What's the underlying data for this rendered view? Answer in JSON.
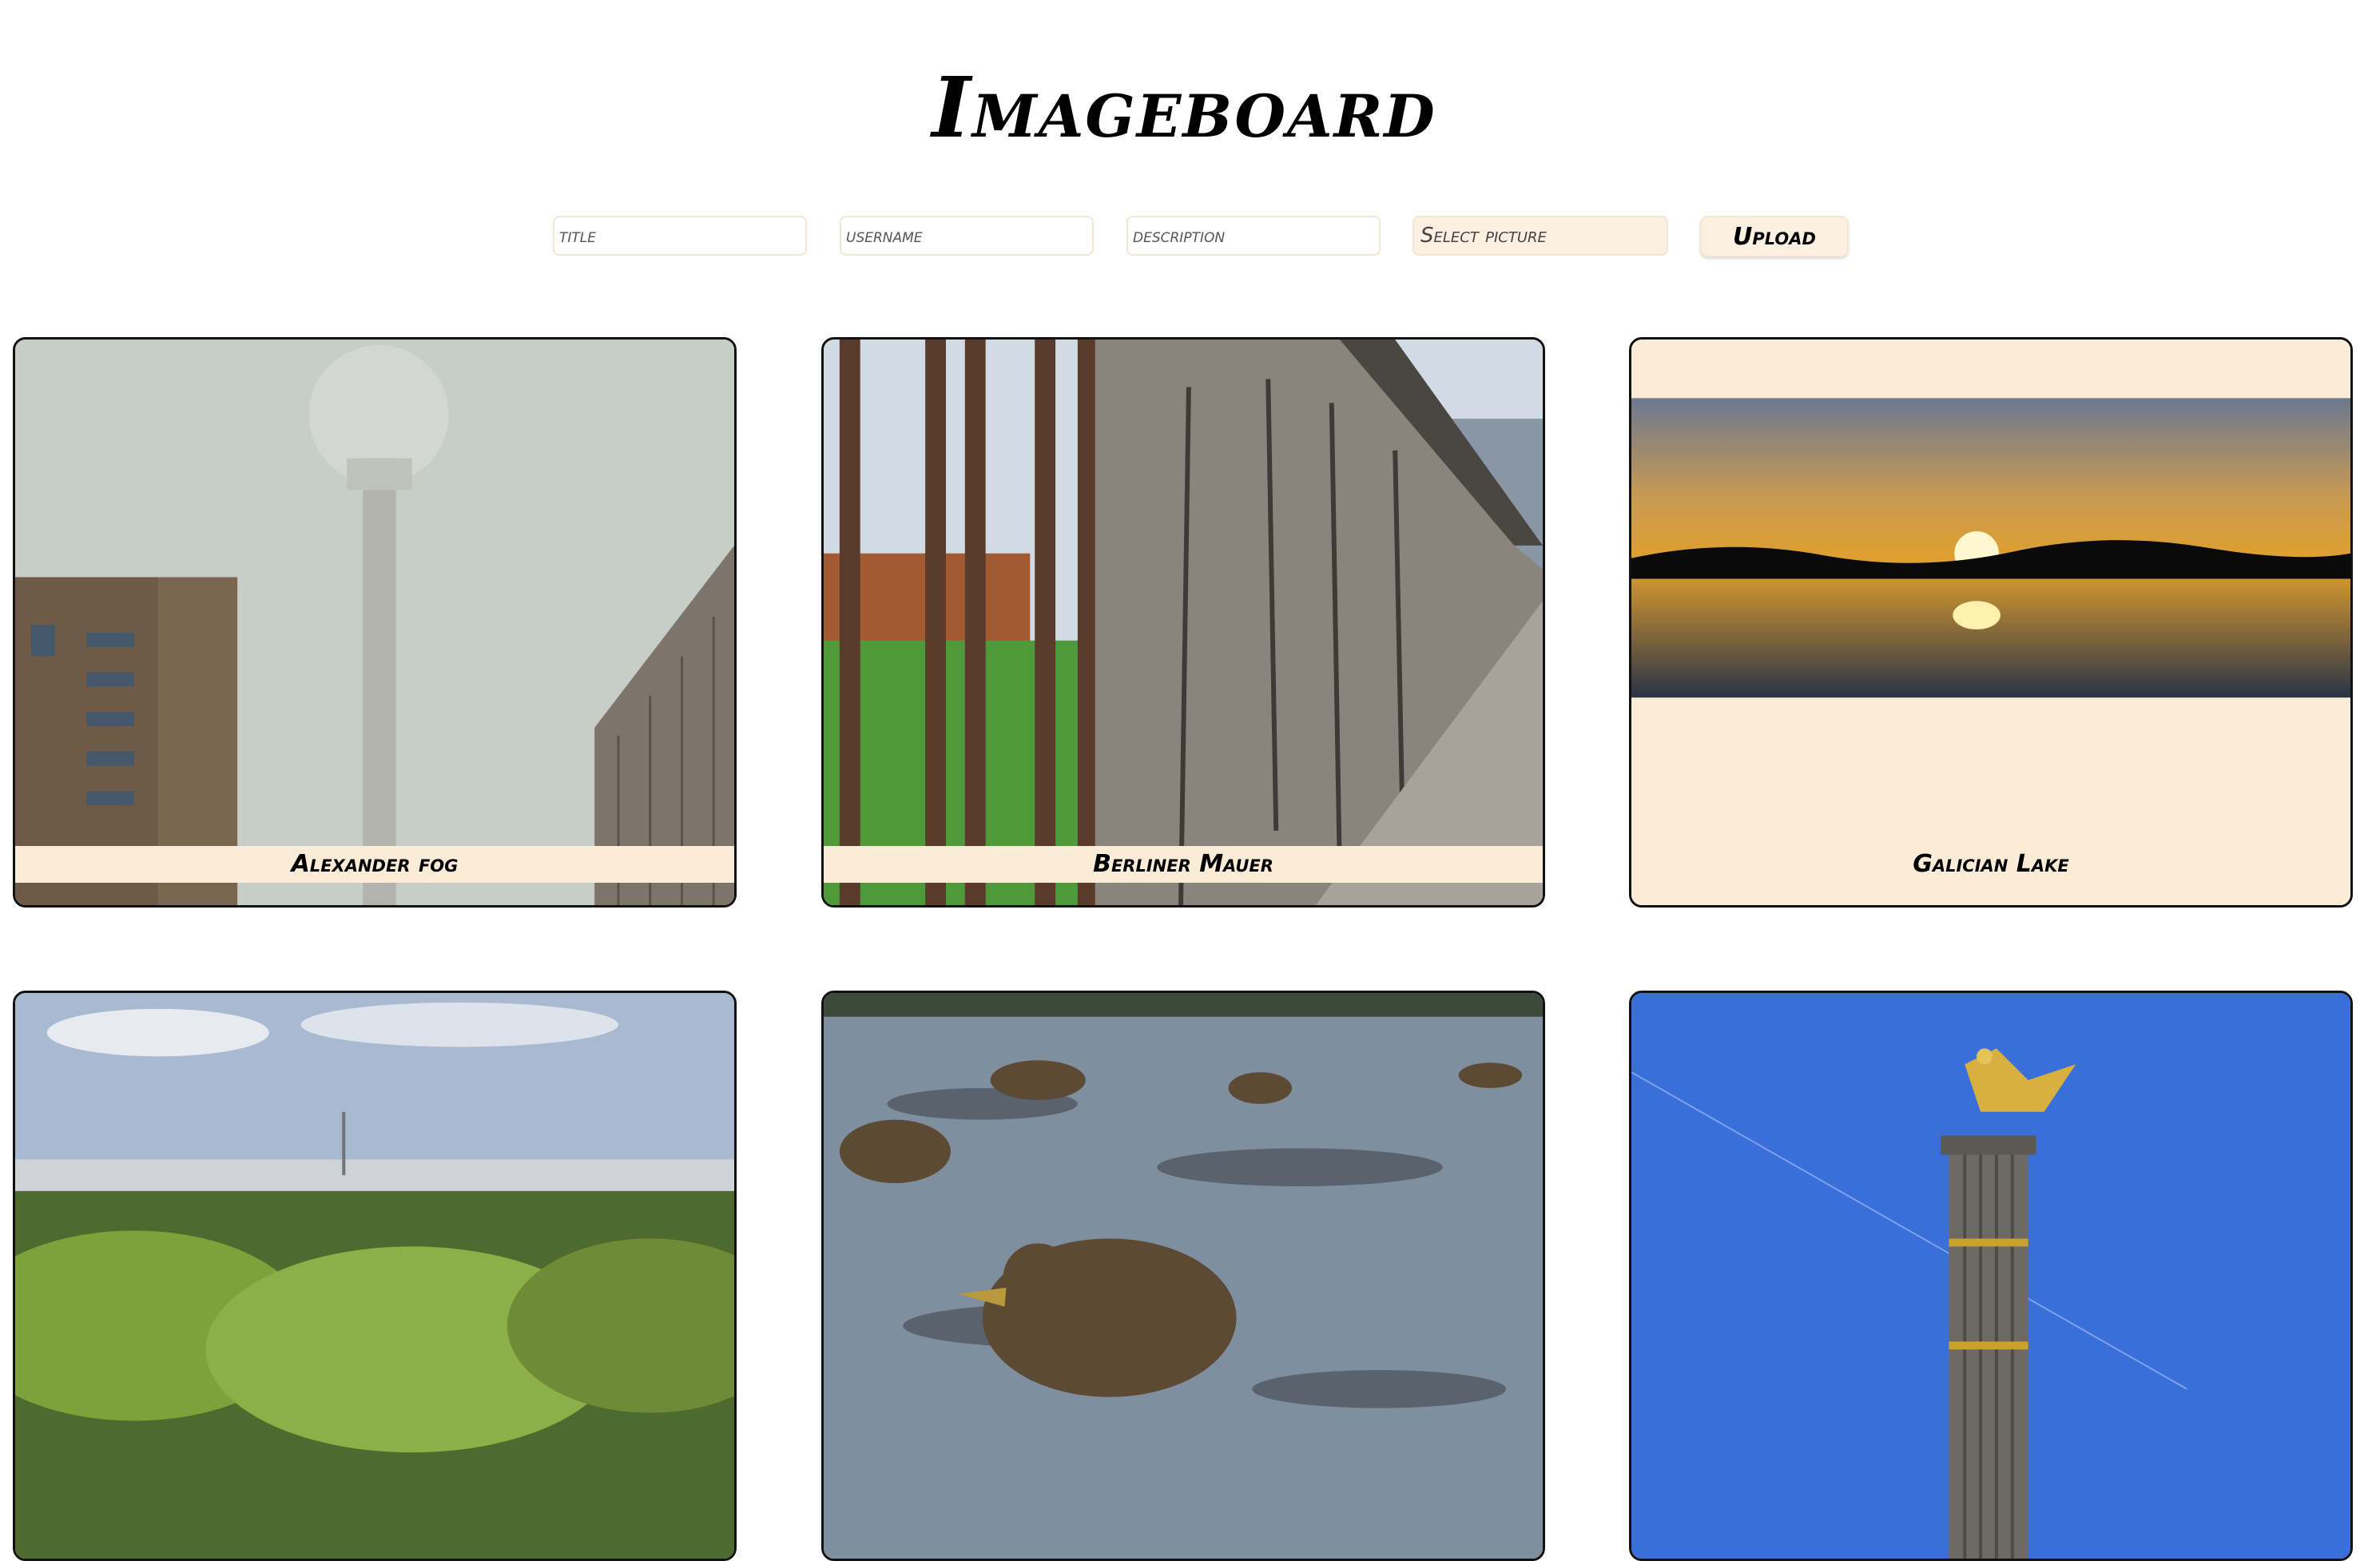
{
  "header": {
    "title": "Imageboard"
  },
  "form": {
    "title_placeholder": "title",
    "username_placeholder": "username",
    "description_placeholder": "description",
    "file_label": "Select picture",
    "upload_label": "Upload"
  },
  "colors": {
    "accent": "#fbecd8",
    "border": "#111111"
  },
  "images": [
    {
      "title": "Alexander fog"
    },
    {
      "title": "Berliner Mauer"
    },
    {
      "title": "Galician Lake"
    },
    {
      "title": ""
    },
    {
      "title": ""
    },
    {
      "title": ""
    }
  ]
}
